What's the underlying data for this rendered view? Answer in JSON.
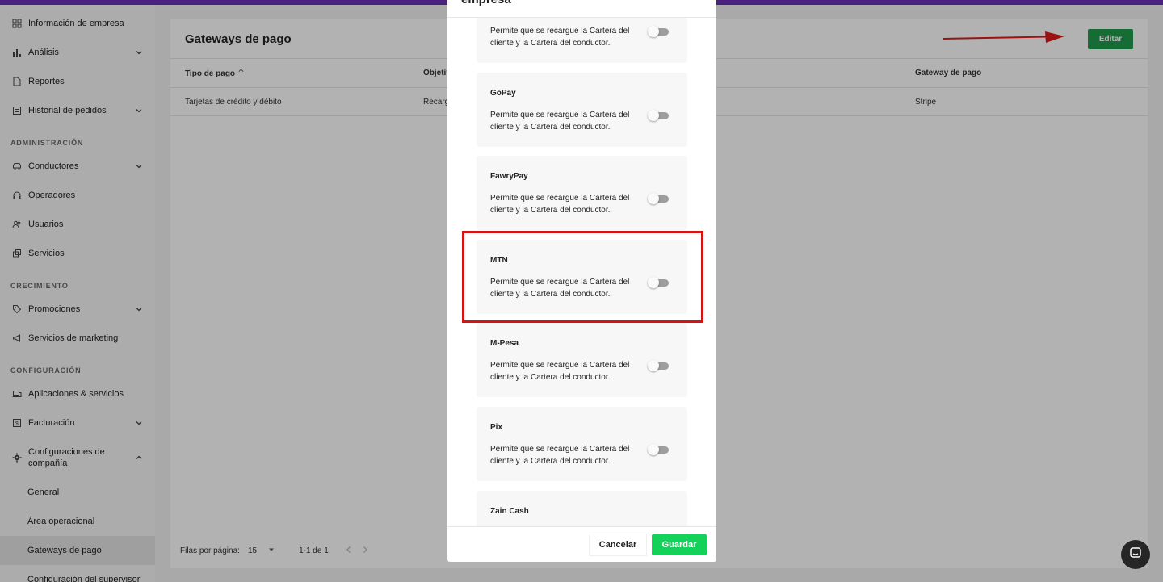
{
  "sidebar": {
    "items": [
      {
        "label": "Información de empresa"
      },
      {
        "label": "Análisis"
      },
      {
        "label": "Reportes"
      },
      {
        "label": "Historial de pedidos"
      },
      {
        "label": "Conductores"
      },
      {
        "label": "Operadores"
      },
      {
        "label": "Usuarios"
      },
      {
        "label": "Servicios"
      },
      {
        "label": "Promociones"
      },
      {
        "label": "Servicios de marketing"
      },
      {
        "label": "Aplicaciones & servicios"
      },
      {
        "label": "Facturación"
      },
      {
        "label": "Configuraciones de compañía"
      },
      {
        "label": "General"
      },
      {
        "label": "Área operacional"
      },
      {
        "label": "Gateways de pago"
      },
      {
        "label": "Configuración del supervisor"
      }
    ],
    "sections": {
      "admin": "ADMINISTRACIÓN",
      "growth": "CRECIMIENTO",
      "config": "CONFIGURACIÓN"
    }
  },
  "main": {
    "title": "Gateways de pago",
    "edit_label": "Editar",
    "columns": [
      "Tipo de pago",
      "Objetiv",
      "Gateway de pago"
    ],
    "rows": [
      {
        "type": "Tarjetas de crédito y débito",
        "target": "Recarg",
        "gateway": "Stripe"
      }
    ],
    "pager": {
      "rows_label": "Filas por página:",
      "rows_value": "15",
      "range": "1-1 de 1"
    }
  },
  "modal": {
    "title": "empresa",
    "description": "Permite que se recargue la Cartera del cliente y la Cartera del conductor.",
    "methods": [
      {
        "name": ""
      },
      {
        "name": "GoPay"
      },
      {
        "name": "FawryPay"
      },
      {
        "name": "MTN"
      },
      {
        "name": "M-Pesa"
      },
      {
        "name": "Pix"
      },
      {
        "name": "Zain Cash"
      }
    ],
    "cancel_label": "Cancelar",
    "save_label": "Guardar"
  },
  "colors": {
    "accent": "#6b2fb3",
    "edit_button": "#1f9b4c",
    "save_button": "#14d15a",
    "highlight": "#d31414"
  }
}
